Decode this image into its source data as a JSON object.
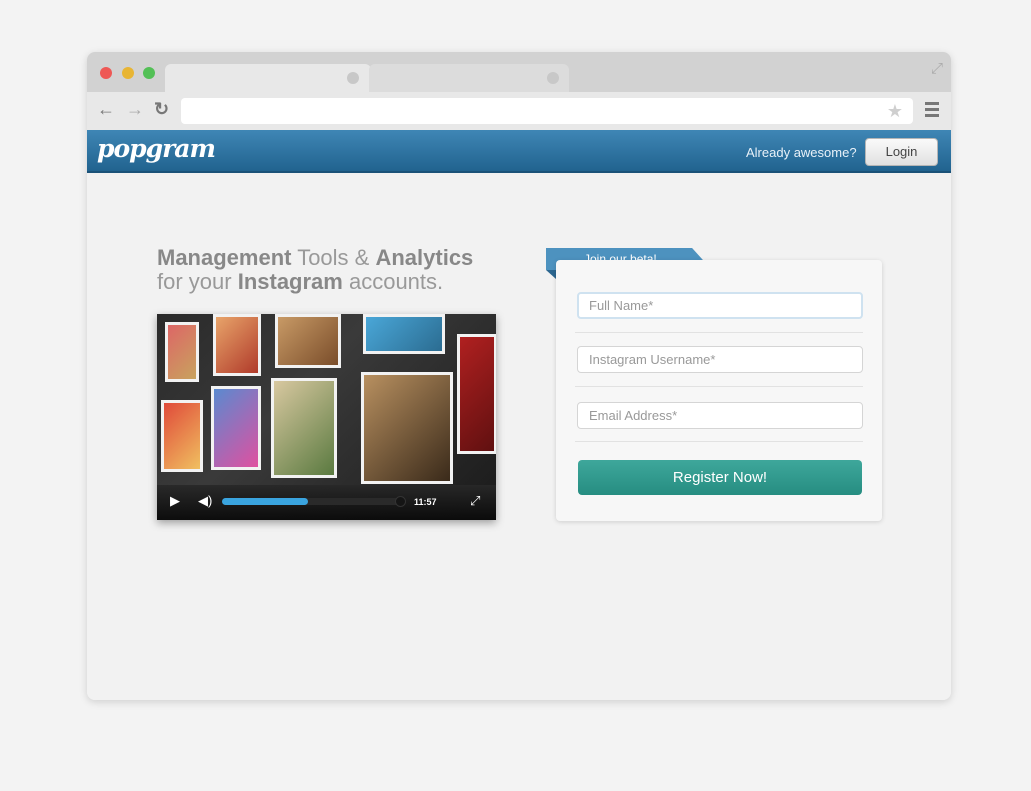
{
  "header": {
    "logo": "popgram",
    "already_text": "Already awesome?",
    "login_label": "Login",
    "brand_color": "#2f739f"
  },
  "hero": {
    "line1_bold1": "Management",
    "line1_mid": " Tools & ",
    "line1_bold2": "Analytics",
    "line2_pre": "for your ",
    "line2_bold": "Instagram",
    "line2_post": " accounts."
  },
  "video": {
    "progress_fraction": 0.47,
    "time": "11:57"
  },
  "form": {
    "ribbon_label": "Join our beta!",
    "fields": [
      {
        "placeholder": "Full Name*"
      },
      {
        "placeholder": "Instagram Username*"
      },
      {
        "placeholder": "Email Address*"
      }
    ],
    "submit_label": "Register Now!",
    "accent_color": "#2c988c"
  }
}
